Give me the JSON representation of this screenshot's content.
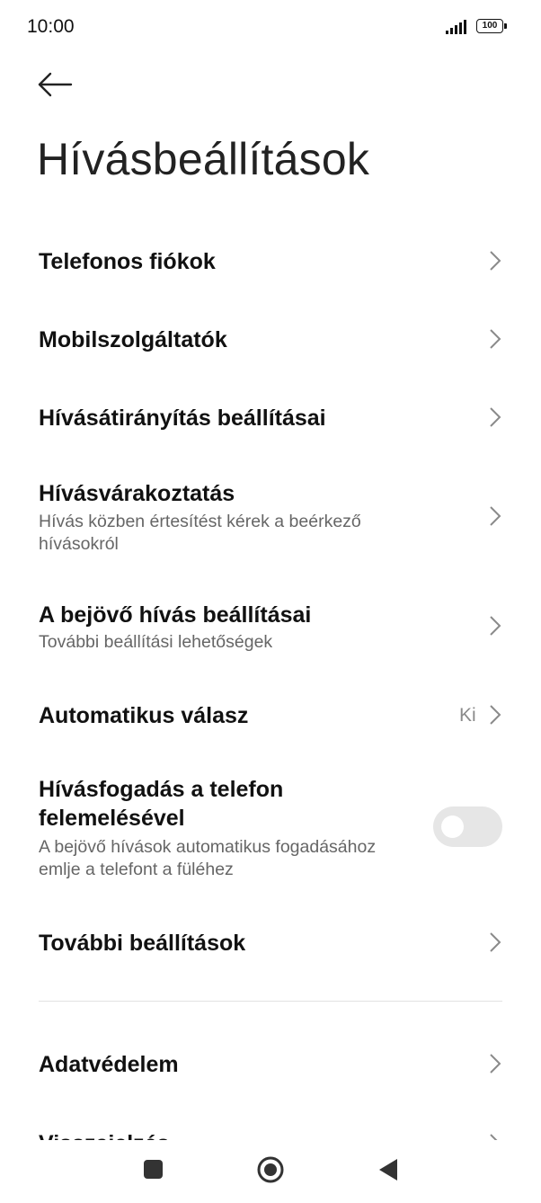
{
  "status_bar": {
    "time": "10:00",
    "battery": "100"
  },
  "page": {
    "title": "Hívásbeállítások"
  },
  "items": [
    {
      "label": "Telefonos fiókok"
    },
    {
      "label": "Mobilszolgáltatók"
    },
    {
      "label": "Hívásátirányítás beállításai"
    },
    {
      "label": "Hívásvárakoztatás",
      "sub_line1": "Hívás közben értesítést kérek a beérkező",
      "sub_line2": "hívásokról"
    },
    {
      "label": "A bejövő hívás beállításai",
      "sub_line1": "További beállítási lehetőségek"
    },
    {
      "label": "Automatikus válasz",
      "value": "Ki"
    },
    {
      "label_line1": "Hívásfogadás a telefon",
      "label_line2": "felemelésével",
      "sub_line1": "A bejövő hívások automatikus fogadásához",
      "sub_line2": "emlje a telefont a füléhez",
      "toggle_on": false
    },
    {
      "label": "További beállítások"
    },
    {
      "label": "Adatvédelem"
    },
    {
      "label": "Visszajelzés"
    }
  ],
  "nav": {
    "buttons": [
      "recents",
      "home",
      "back"
    ]
  }
}
